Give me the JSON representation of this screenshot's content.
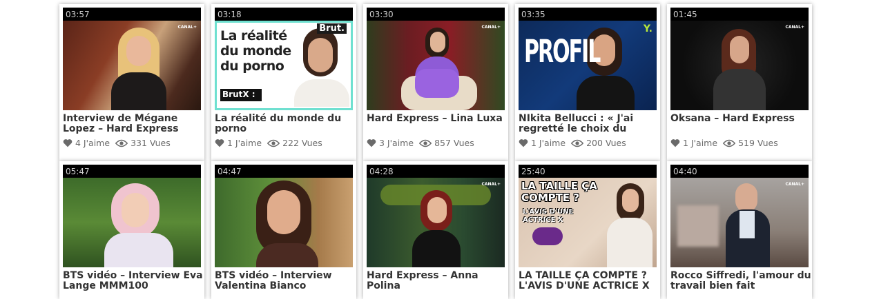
{
  "videos": [
    {
      "duration": "03:57",
      "title": "Interview de Mégane Lopez – Hard Express",
      "likes": "4 J'aime",
      "views": "331 Vues",
      "channel": "CANAL+"
    },
    {
      "duration": "03:18",
      "title": "La réalité du monde du porno",
      "likes": "1 J'aime",
      "views": "222 Vues",
      "overlay": "La réalité du monde du porno",
      "overlay_tag": "BrutX :",
      "brand": "Brut."
    },
    {
      "duration": "03:30",
      "title": "Hard Express – Lina Luxa",
      "likes": "3 J'aime",
      "views": "857 Vues",
      "channel": "CANAL+"
    },
    {
      "duration": "03:35",
      "title": "NIkita Bellucci : « J'ai regretté le choix du",
      "likes": "1 J'aime",
      "views": "200 Vues",
      "overlay": "PROFIL",
      "brand": "Y."
    },
    {
      "duration": "01:45",
      "title": "Oksana – Hard Express",
      "likes": "1 J'aime",
      "views": "519 Vues",
      "channel": "CANAL+"
    },
    {
      "duration": "05:47",
      "title": "BTS vidéo – Interview Eva Lange MMM100"
    },
    {
      "duration": "04:47",
      "title": "BTS vidéo – Interview Valentina Bianco"
    },
    {
      "duration": "04:28",
      "title": "Hard Express – Anna Polina",
      "channel": "CANAL+"
    },
    {
      "duration": "25:40",
      "title": "LA TAILLE ÇA COMPTE ? L'AVIS D'UNE ACTRICE X",
      "overlay": "LA TAILLE ÇA COMPTE ?",
      "overlay_sub": "L'AVIS D'UNE ACTRICE X"
    },
    {
      "duration": "04:40",
      "title": "Rocco Siffredi, l'amour du travail bien fait",
      "channel": "CANAL+"
    }
  ],
  "colors": {
    "title": "#333333",
    "meta": "#6a6a6a",
    "thumb_bg": "#000000"
  }
}
